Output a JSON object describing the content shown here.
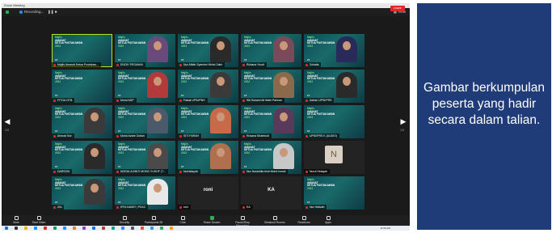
{
  "window": {
    "title": "Zoom Meeting"
  },
  "status": {
    "recording": "Recording...",
    "view_label": "View"
  },
  "poster": {
    "brand": "Majlis",
    "line1": "AMANAT",
    "line2": "KETUA PUSTAKAWAN",
    "year": "2022",
    "date": "17"
  },
  "tiles": [
    {
      "name": "Majlis Amanat Ketua Pustakaw...",
      "type": "poster",
      "active": true
    },
    {
      "name": "ENCIK PEGAWAI",
      "type": "person",
      "shirt": "#6a4a7a"
    },
    {
      "name": "Nur Afifah Syamimi Mohd Zakri",
      "type": "person",
      "shirt": "#2a2a2a"
    },
    {
      "name": "Rohana Yusuf",
      "type": "person",
      "shirt": "#7a4a5a"
    },
    {
      "name": "Zuhaila",
      "type": "person",
      "shirt": "#2a2a5a"
    },
    {
      "name": "FITGA OTB",
      "type": "poster"
    },
    {
      "name": "Mohd ADP",
      "type": "person",
      "shirt": "#b23a3a"
    },
    {
      "name": "Faisal UPSI/PNS",
      "type": "person",
      "shirt": "#3a3a3a"
    },
    {
      "name": "Siti Suhaini Ali Wahi Paiman",
      "type": "person",
      "shirt": "#8a6a4a"
    },
    {
      "name": "Adrian UPSI/PRS",
      "type": "person",
      "shirt": "#2a2a2a"
    },
    {
      "name": "Ahmad Nur",
      "type": "person",
      "shirt": "#3a3a3a"
    },
    {
      "name": "Mohd Azizie Dollah",
      "type": "person",
      "shirt": "#4a5a6a"
    },
    {
      "name": "SITI FARAH",
      "type": "person",
      "shirt": "#c86a4a"
    },
    {
      "name": "Rosana Shahbudi",
      "type": "person",
      "shirt": "#5a3a5a"
    },
    {
      "name": "UPSI/PRS K (AUDIO)",
      "type": "poster"
    },
    {
      "name": "DARSON",
      "type": "person",
      "shirt": "#2a2a2a"
    },
    {
      "name": "NORULA BINTI MOHD YUSOF (T...",
      "type": "person",
      "shirt": "#4a4a4a"
    },
    {
      "name": "Norhidayah",
      "type": "person",
      "shirt": "#b07050"
    },
    {
      "name": "Nur Noraidilla binti Mohd Ismail",
      "type": "person",
      "shirt": "#c8c8c8"
    },
    {
      "name": "Nurul Hidayah",
      "type": "initial",
      "initial": "N"
    },
    {
      "name": "ZIA",
      "type": "person",
      "shirt": "#3a3a3a"
    },
    {
      "name": "IFFA NASIR | PSAC",
      "type": "person",
      "shirt": "#e8e8e8"
    },
    {
      "name": "roni",
      "type": "name"
    },
    {
      "name": "KA",
      "type": "name"
    },
    {
      "name": "Nur Hafizah",
      "type": "poster"
    }
  ],
  "pagination": {
    "left": "1/3",
    "right": "1/3"
  },
  "toolbar": [
    {
      "label": "Mute",
      "icon": "microphone-icon"
    },
    {
      "label": "Start Video",
      "icon": "video-icon"
    },
    {
      "label": "Security",
      "icon": "shield-icon"
    },
    {
      "label": "Participants",
      "icon": "participants-icon",
      "count": "95"
    },
    {
      "label": "Chat",
      "icon": "chat-icon"
    },
    {
      "label": "Share Screen",
      "icon": "share-screen-icon"
    },
    {
      "label": "Pause/Stop Recording",
      "icon": "record-icon"
    },
    {
      "label": "Breakout Rooms",
      "icon": "breakout-rooms-icon"
    },
    {
      "label": "Reactions",
      "icon": "reactions-icon"
    },
    {
      "label": "Apps",
      "icon": "apps-icon"
    }
  ],
  "leave_label": "Leave",
  "taskbar": {
    "time": "11:56 AM"
  },
  "caption": {
    "text": "Gambar berkumpulan peserta yang hadir secara dalam talian."
  },
  "colors": {
    "caption_bg": "#1f3b78",
    "active_speaker": "#b5e61d",
    "leave": "#e02828",
    "accent": "#2d8cff"
  }
}
